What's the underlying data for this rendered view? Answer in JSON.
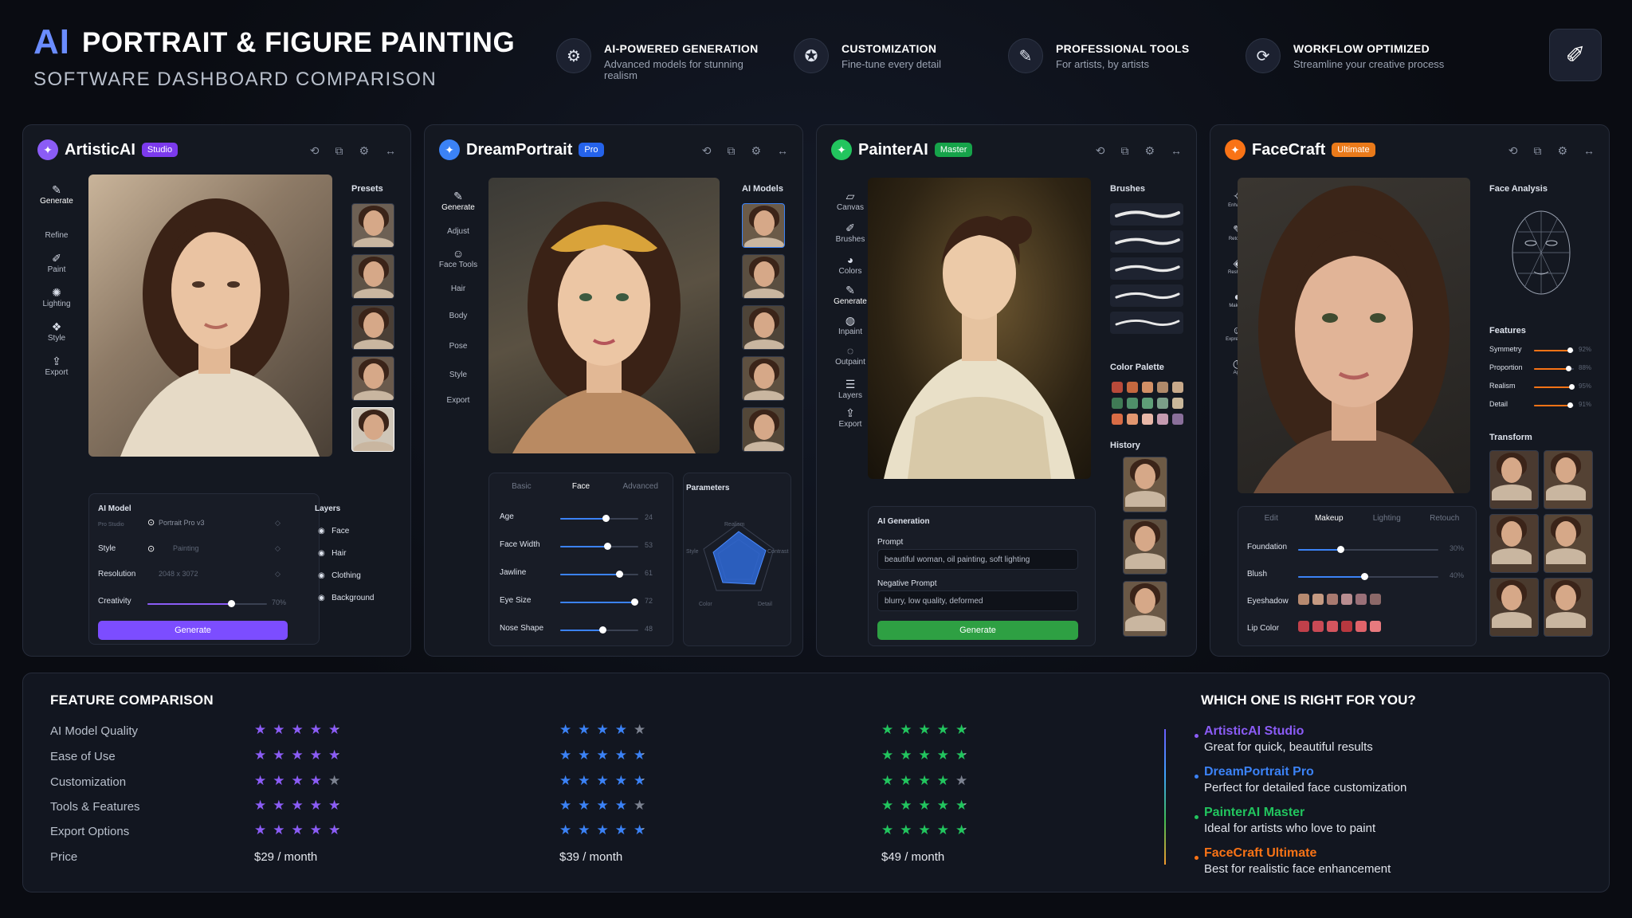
{
  "header": {
    "logo": "AI",
    "title": "PORTRAIT & FIGURE PAINTING",
    "subtitle": "SOFTWARE DASHBOARD COMPARISON",
    "features": [
      {
        "icon": "gear-icon",
        "glyph": "⚙",
        "title": "AI-POWERED GENERATION",
        "desc": "Advanced models for stunning realism"
      },
      {
        "icon": "customize-icon",
        "glyph": "✪",
        "title": "CUSTOMIZATION",
        "desc": "Fine-tune every detail"
      },
      {
        "icon": "tools-icon",
        "glyph": "✎",
        "title": "PROFESSIONAL TOOLS",
        "desc": "For artists, by artists"
      },
      {
        "icon": "workflow-icon",
        "glyph": "⟳",
        "title": "WORKFLOW OPTIMIZED",
        "desc": "Streamline your creative process"
      }
    ]
  },
  "panels": [
    {
      "name": "ArtisticAI",
      "badge": "Studio",
      "color": "#8b5cf6",
      "nav": [
        "Generate",
        "Refine",
        "Paint",
        "Lighting",
        "Style",
        "Export"
      ],
      "presets_title": "Presets",
      "model_title": "AI Model",
      "model_value": "Portrait Pro v3",
      "model_sub": "Pro Studio",
      "style_label": "Style",
      "style_value": "Painting",
      "res_label": "Resolution",
      "res_value": "2048 x 3072",
      "creativity_label": "Creativity",
      "creativity_value": "70%",
      "creativity": 0.7,
      "layers_title": "Layers",
      "layers": [
        "Face",
        "Hair",
        "Clothing",
        "Background"
      ],
      "button": "Generate"
    },
    {
      "name": "DreamPortrait",
      "badge": "Pro",
      "color": "#3b82f6",
      "nav": [
        "Generate",
        "Adjust",
        "Face Tools",
        "Hair",
        "Body",
        "Pose",
        "Style",
        "Export"
      ],
      "models_title": "AI Models",
      "tabs": [
        "Basic",
        "Face",
        "Advanced"
      ],
      "sliders": [
        {
          "label": "Age",
          "value": "24",
          "pos": 0.58
        },
        {
          "label": "Face Width",
          "value": "53",
          "pos": 0.6
        },
        {
          "label": "Jawline",
          "value": "61",
          "pos": 0.76
        },
        {
          "label": "Eye Size",
          "value": "72",
          "pos": 0.95
        },
        {
          "label": "Nose Shape",
          "value": "48",
          "pos": 0.54
        }
      ],
      "params_title": "Parameters",
      "radar": [
        "Realism",
        "Contrast",
        "Detail",
        "Color",
        "Style"
      ]
    },
    {
      "name": "PainterAI",
      "badge": "Master",
      "color": "#22c55e",
      "nav": [
        "Canvas",
        "Brushes",
        "Colors",
        "Generate",
        "Inpaint",
        "Outpaint",
        "Layers",
        "Export"
      ],
      "brushes_title": "Brushes",
      "palette_title": "Color Palette",
      "history_title": "History",
      "palette": [
        "#b84a3a",
        "#c4683f",
        "#d29066",
        "#b08a6a",
        "#c8a98a",
        "#3f7a55",
        "#4f8f6a",
        "#5f9e78",
        "#7a9e88",
        "#c9b79a",
        "#d96c45",
        "#e29770",
        "#e8b7a8",
        "#c59bb0",
        "#8a6f9a"
      ],
      "gen_title": "AI Generation",
      "prompt_label": "Prompt",
      "prompt": "beautiful woman, oil painting, soft lighting",
      "neg_label": "Negative Prompt",
      "negative": "blurry, low quality, deformed",
      "button": "Generate"
    },
    {
      "name": "FaceCraft",
      "badge": "Ultimate",
      "color": "#f97316",
      "nav": [
        "Enhance",
        "Retouch",
        "Reshape",
        "Makeup",
        "Expression",
        "Age"
      ],
      "analysis_title": "Face Analysis",
      "features_title": "Features",
      "features": [
        {
          "label": "Symmetry",
          "value": "92%",
          "pos": 0.92
        },
        {
          "label": "Proportion",
          "value": "88%",
          "pos": 0.88
        },
        {
          "label": "Realism",
          "value": "95%",
          "pos": 0.95
        },
        {
          "label": "Detail",
          "value": "91%",
          "pos": 0.91
        }
      ],
      "transform_title": "Transform",
      "tabs": [
        "Edit",
        "Makeup",
        "Lighting",
        "Retouch"
      ],
      "foundation_label": "Foundation",
      "foundation_value": "30%",
      "foundation": 0.3,
      "blush_label": "Blush",
      "blush_value": "40%",
      "blush": 0.47,
      "eyeshadow_label": "Eyeshadow",
      "lip_label": "Lip Color",
      "eyeshadow": [
        "#b78a70",
        "#c59a82",
        "#a97a70",
        "#b88d90",
        "#9a7078",
        "#8b6868"
      ],
      "lips": [
        "#c0404a",
        "#c94a55",
        "#d4555e",
        "#b8383f",
        "#e0636a",
        "#e87a7e"
      ]
    }
  ],
  "comparison": {
    "title": "FEATURE COMPARISON",
    "rows": [
      "AI Model Quality",
      "Ease of Use",
      "Customization",
      "Tools & Features",
      "Export Options",
      "Price"
    ],
    "products": [
      {
        "color": "#8b5cf6",
        "ratings": [
          4.5,
          4.5,
          4,
          4.5,
          4.5
        ],
        "price": "$29 / month"
      },
      {
        "color": "#3b82f6",
        "ratings": [
          4,
          4.5,
          4.5,
          4,
          4.5
        ],
        "price": "$39 / month"
      },
      {
        "color": "#22c55e",
        "ratings": [
          4.5,
          4.5,
          4,
          4.5,
          4.5
        ],
        "price": "$49 / month"
      }
    ]
  },
  "recommend": {
    "title": "WHICH ONE IS RIGHT FOR YOU?",
    "items": [
      {
        "name": "ArtisticAI Studio",
        "desc": "Great for quick, beautiful results",
        "color": "#8b5cf6"
      },
      {
        "name": "DreamPortrait Pro",
        "desc": "Perfect for detailed face customization",
        "color": "#3b82f6"
      },
      {
        "name": "PainterAI Master",
        "desc": "Ideal for artists who love to paint",
        "color": "#22c55e"
      },
      {
        "name": "FaceCraft Ultimate",
        "desc": "Best for realistic face enhancement",
        "color": "#f97316"
      }
    ]
  }
}
